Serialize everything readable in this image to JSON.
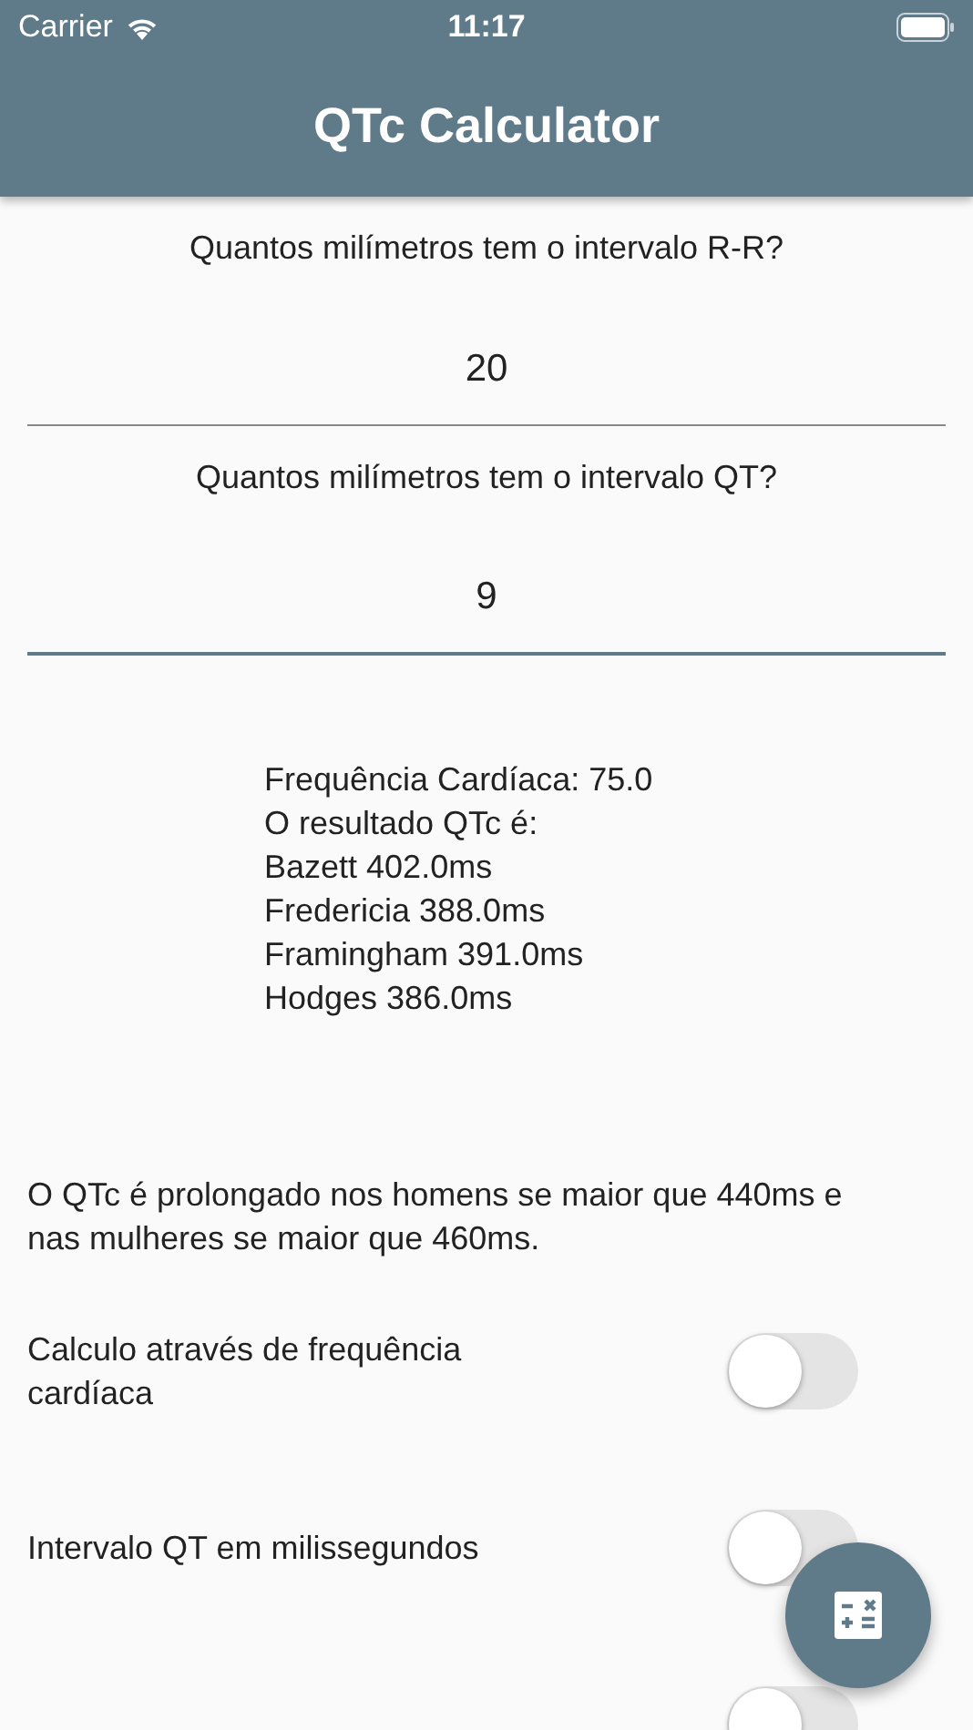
{
  "status_bar": {
    "carrier": "Carrier",
    "time": "11:17"
  },
  "app_bar": {
    "title": "QTc Calculator"
  },
  "fields": [
    {
      "label": "Quantos milímetros tem o intervalo R-R?",
      "value": "20",
      "focused": false
    },
    {
      "label": "Quantos milímetros tem o intervalo QT?",
      "value": "9",
      "focused": true
    }
  ],
  "results": [
    "Frequência Cardíaca: 75.0",
    "O resultado QTc é:",
    "Bazett 402.0ms",
    "Fredericia 388.0ms",
    "Framingham 391.0ms",
    "Hodges 386.0ms"
  ],
  "note": "O QTc é prolongado nos homens se maior que 440ms e nas mulheres se maior que 460ms.",
  "toggles": [
    {
      "label": "Calculo através de frequência cardíaca",
      "on": false
    },
    {
      "label": "Intervalo QT em milissegundos",
      "on": false
    },
    {
      "on": false
    }
  ]
}
